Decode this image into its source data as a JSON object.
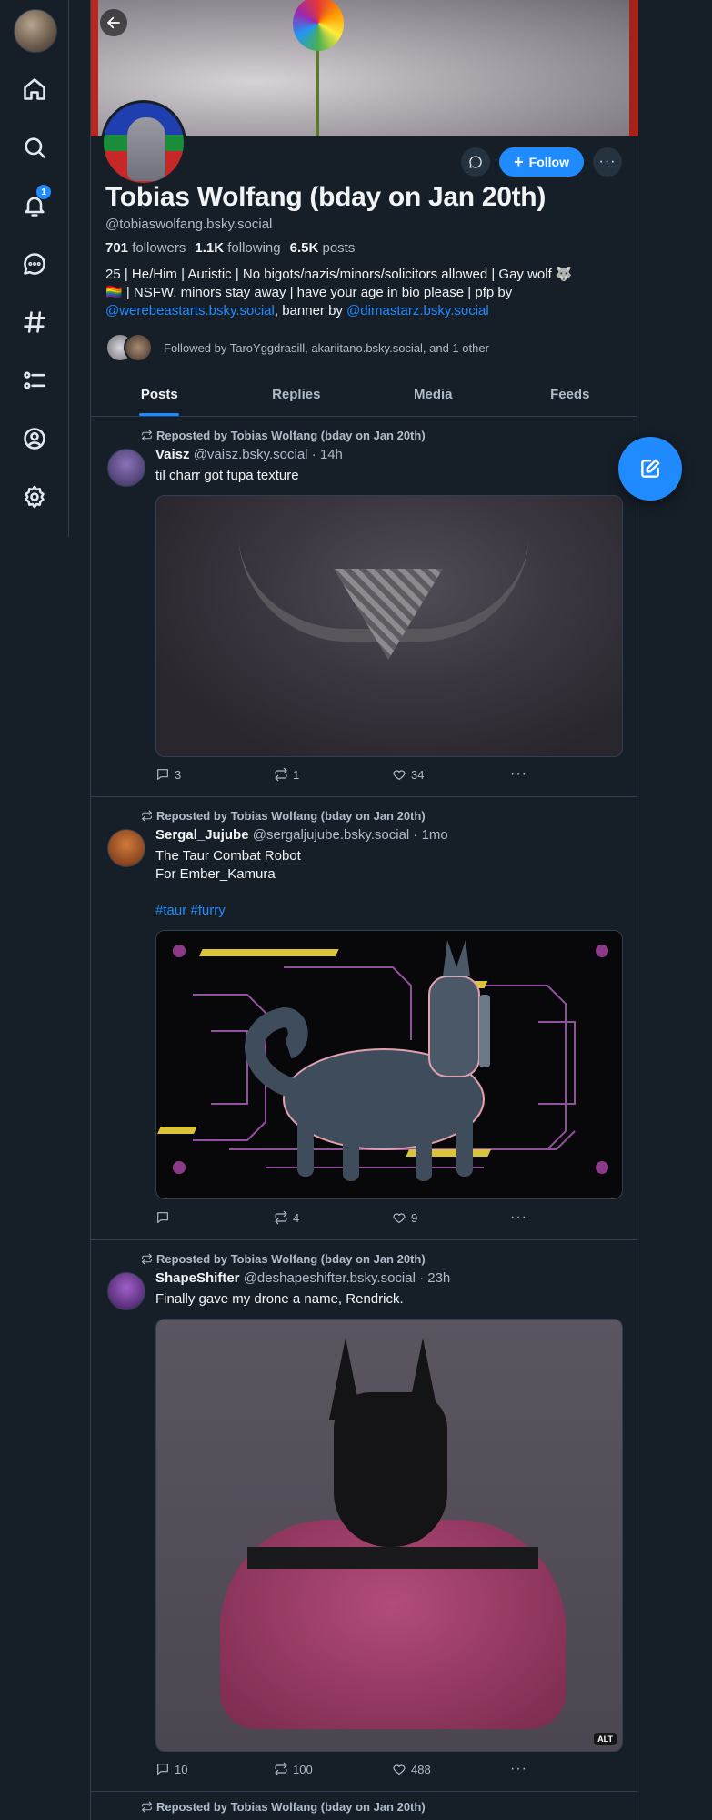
{
  "nav": {
    "notifications_badge": "1",
    "items": [
      "home",
      "search",
      "notifications",
      "chat",
      "feeds",
      "lists",
      "profile",
      "settings"
    ]
  },
  "profile": {
    "display_name": "Tobias Wolfang (bday on Jan 20th)",
    "handle": "@tobiaswolfang.bsky.social",
    "followers_count": "701",
    "followers_label": "followers",
    "following_count": "1.1K",
    "following_label": "following",
    "posts_count": "6.5K",
    "posts_label": "posts",
    "bio_line1": "25 | He/Him | Autistic | No bigots/nazis/minors/solicitors allowed | Gay wolf 🐺",
    "bio_line2": "🏳️‍🌈 | NSFW, minors stay away | have your age in bio please | pfp by",
    "bio_link1": "@werebeastarts.bsky.social",
    "bio_mid": ", banner by ",
    "bio_link2": "@dimastarz.bsky.social",
    "followed_by": "Followed by TaroYggdrasill, akariitano.bsky.social, and 1 other",
    "follow_label": "Follow"
  },
  "tabs": [
    "Posts",
    "Replies",
    "Media",
    "Feeds"
  ],
  "posts": [
    {
      "repost_by": "Reposted by Tobias Wolfang (bday on Jan 20th)",
      "author": "Vaisz",
      "handle": "@vaisz.bsky.social · 14h",
      "text": "til charr got fupa texture",
      "replies": "3",
      "reposts": "1",
      "likes": "34"
    },
    {
      "repost_by": "Reposted by Tobias Wolfang (bday on Jan 20th)",
      "author": "Sergal_Jujube",
      "handle": "@sergaljujube.bsky.social · 1mo",
      "text_line1": "The Taur Combat Robot",
      "text_line2": "For Ember_Kamura",
      "tags": "#taur #furry",
      "replies": "",
      "reposts": "4",
      "likes": "9"
    },
    {
      "repost_by": "Reposted by Tobias Wolfang (bday on Jan 20th)",
      "author": "ShapeShifter",
      "handle": "@deshapeshifter.bsky.social · 23h",
      "text": "Finally gave my drone a name, Rendrick.",
      "alt": "ALT",
      "replies": "10",
      "reposts": "100",
      "likes": "488"
    },
    {
      "repost_by": "Reposted by Tobias Wolfang (bday on Jan 20th)"
    }
  ],
  "colors": {
    "accent": "#208bfe",
    "background": "#161e27",
    "muted": "#aebbc9",
    "border": "#2e4052"
  }
}
